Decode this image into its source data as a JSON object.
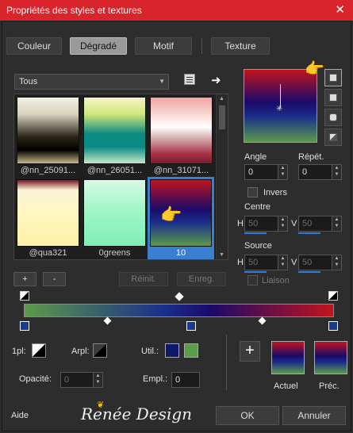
{
  "window": {
    "title": "Propriétés des styles et textures",
    "close": "✕"
  },
  "tabs": [
    {
      "label": "Couleur"
    },
    {
      "label": "Dégradé"
    },
    {
      "label": "Motif"
    },
    {
      "label": "Texture"
    }
  ],
  "filter": {
    "value": "Tous"
  },
  "gradients": [
    {
      "label": "@nn_25091..."
    },
    {
      "label": "@nn_26051..."
    },
    {
      "label": "@nn_31071..."
    },
    {
      "label": "@qua321"
    },
    {
      "label": "0greens"
    },
    {
      "label": "10"
    }
  ],
  "list_buttons": {
    "add": "+",
    "remove": "-",
    "reset": "Réinit.",
    "save": "Enreg."
  },
  "settings": {
    "angle_label": "Angle",
    "angle_value": "0",
    "repeat_label": "Répét.",
    "repeat_value": "0",
    "invert_label": "Invers",
    "center_label": "Centre",
    "center_h_label": "H",
    "center_h": "50",
    "center_v_label": "V",
    "center_v": "50",
    "source_label": "Source",
    "source_h_label": "H",
    "source_h": "50",
    "source_v_label": "V",
    "source_v": "50",
    "link_label": "Liaison"
  },
  "bottom": {
    "opacity_label": "1pl:",
    "arpl_label": "Arpl:",
    "util_label": "Util.:",
    "opacite_label": "Opacité:",
    "opacite_value": "0",
    "empl_label": "Empl.:",
    "empl_value": "0",
    "current_label": "Actuel",
    "previous_label": "Préc."
  },
  "footer": {
    "help": "Aide",
    "ok": "OK",
    "cancel": "Annuler"
  },
  "watermark": "Renée Design",
  "colors": {
    "title_bar": "#d9242c",
    "accent": "#3a7ecf",
    "util_dark": "#0d1a6b",
    "util_green": "#5a9e4a"
  }
}
